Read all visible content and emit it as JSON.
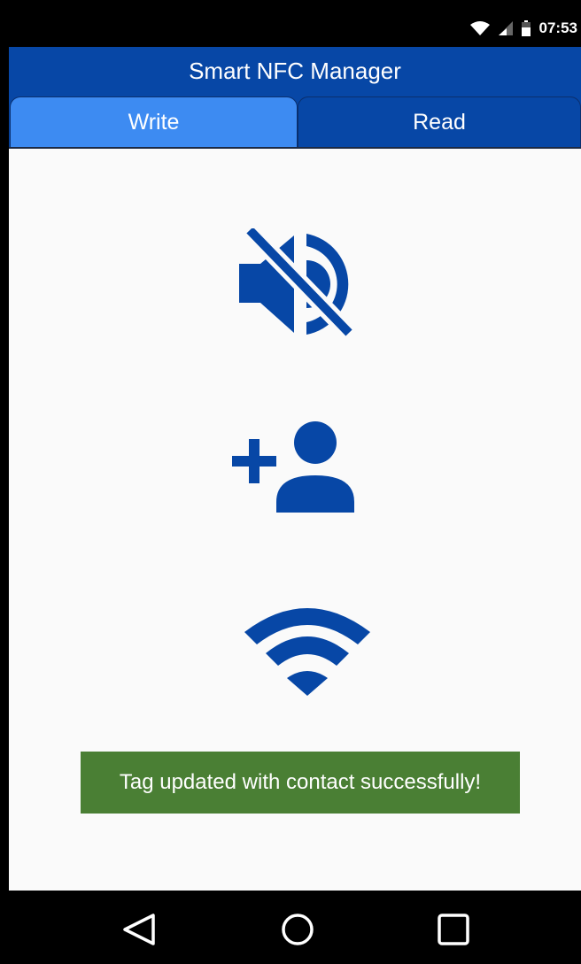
{
  "status_bar": {
    "time": "07:53",
    "icons": [
      "wifi-icon",
      "signal-icon",
      "battery-icon"
    ]
  },
  "app": {
    "title": "Smart NFC Manager"
  },
  "tabs": [
    {
      "label": "Write",
      "selected": true
    },
    {
      "label": "Read",
      "selected": false
    }
  ],
  "actions": [
    {
      "icon": "mute-icon"
    },
    {
      "icon": "add-contact-icon"
    },
    {
      "icon": "wifi-icon"
    }
  ],
  "toast": {
    "message": "Tag updated with contact successfully!"
  },
  "navigation": {
    "icons": [
      "back-icon",
      "home-icon",
      "recent-apps-icon"
    ]
  },
  "colors": {
    "primary": "#0747a6",
    "tab_selected": "#3d8bf2",
    "toast_bg": "#4a7f34",
    "content_bg": "#fafafa"
  }
}
